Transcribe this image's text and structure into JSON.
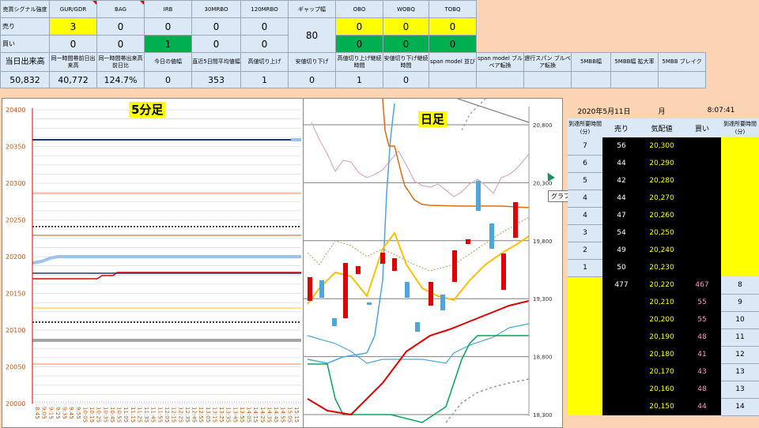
{
  "signal": {
    "headers": [
      "売買シグナル強度",
      "GUR/GDR",
      "BAG",
      "IRB",
      "30MRBO",
      "120MRBO",
      "ギャップ幅",
      "OBO",
      "WOBQ",
      "TOBQ"
    ],
    "rows": [
      {
        "label": "売り",
        "values": [
          "3",
          "0",
          "0",
          "0",
          "0"
        ],
        "right": [
          "0",
          "0",
          "0"
        ]
      },
      {
        "label": "買い",
        "values": [
          "0",
          "0",
          "1",
          "0",
          "0"
        ],
        "right": [
          "0",
          "0",
          "0"
        ]
      }
    ],
    "gap": "80"
  },
  "volume": {
    "headers": [
      "当日出来高",
      "同一時間帯前日出来高",
      "同一時間帯出来高前日比",
      "今日の値幅",
      "直近5日間平均値幅",
      "高値切り上げ",
      "安値切り下げ",
      "高値切り上げ継続時間",
      "安値切り下げ継続時間",
      "span model 並び",
      "span model ブルベア転換",
      "遅行スパン ブルベア転換",
      "5MBB幅",
      "5MBB幅 拡大率",
      "5MBB ブレイク"
    ],
    "values": [
      "50,832",
      "40,772",
      "124.7%",
      "0",
      "353",
      "1",
      "0",
      "1",
      "0",
      "",
      "",
      "",
      "",
      "",
      ""
    ]
  },
  "chart5m": {
    "title": "5分足",
    "ylabels": [
      "20400",
      "20350",
      "20300",
      "20250",
      "20200",
      "20150",
      "20100",
      "20050",
      "20000"
    ],
    "xlabels": [
      "8:45",
      "9:05",
      "9:15",
      "9:25",
      "9:35",
      "9:45",
      "9:55",
      "10:05",
      "10:15",
      "10:25",
      "10:35",
      "10:45",
      "10:55",
      "11:05",
      "11:15",
      "11:25",
      "11:35",
      "11:45",
      "11:55",
      "12:05",
      "12:15",
      "12:25",
      "12:35",
      "12:45",
      "12:55",
      "13:05",
      "13:15",
      "13:25",
      "13:35",
      "13:45",
      "13:55",
      "14:05",
      "14:15",
      "14:25",
      "14:35",
      "14:45",
      "14:55",
      "15:05",
      "15:15"
    ]
  },
  "chartD": {
    "title": "日足",
    "ylabels": [
      "20,800",
      "20,300",
      "19,800",
      "19,300",
      "18,800",
      "18,300"
    ],
    "tooltip": "グラフ エリア"
  },
  "board": {
    "date": "2020年5月11日",
    "day": "月",
    "time": "8:07:41",
    "headers": [
      "到達所要時間(分)",
      "売り",
      "気配値",
      "買い",
      "到達所要時間(分)"
    ],
    "asks": [
      {
        "t": "7",
        "sell": "56",
        "price": "20,300"
      },
      {
        "t": "6",
        "sell": "44",
        "price": "20,290"
      },
      {
        "t": "5",
        "sell": "42",
        "price": "20,280"
      },
      {
        "t": "4",
        "sell": "44",
        "price": "20,270"
      },
      {
        "t": "4",
        "sell": "47",
        "price": "20,260"
      },
      {
        "t": "3",
        "sell": "54",
        "price": "20,250"
      },
      {
        "t": "2",
        "sell": "49",
        "price": "20,240"
      },
      {
        "t": "1",
        "sell": "50",
        "price": "20,230"
      }
    ],
    "bids": [
      {
        "sell": "477",
        "price": "20,220",
        "buy": "467",
        "t": "8"
      },
      {
        "sell": "",
        "price": "20,210",
        "buy": "55",
        "t": "9"
      },
      {
        "sell": "",
        "price": "20,200",
        "buy": "55",
        "t": "10"
      },
      {
        "sell": "",
        "price": "20,190",
        "buy": "48",
        "t": "11"
      },
      {
        "sell": "",
        "price": "20,180",
        "buy": "41",
        "t": "12"
      },
      {
        "sell": "",
        "price": "20,170",
        "buy": "43",
        "t": "13"
      },
      {
        "sell": "",
        "price": "20,160",
        "buy": "48",
        "t": "13"
      },
      {
        "sell": "",
        "price": "20,150",
        "buy": "44",
        "t": "14"
      }
    ]
  }
}
